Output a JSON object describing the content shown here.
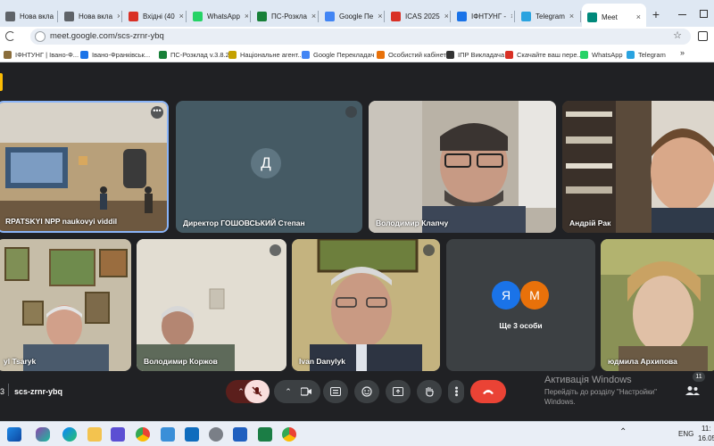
{
  "browser": {
    "tabs": [
      {
        "label": "Нова вкла",
        "icon": "new-tab-icon",
        "color": "#5f6368"
      },
      {
        "label": "Нова вкла",
        "icon": "new-tab-icon",
        "color": "#5f6368"
      },
      {
        "label": "Вхідні (40",
        "icon": "gmail-icon",
        "color": "#d93025"
      },
      {
        "label": "WhatsApp",
        "icon": "whatsapp-icon",
        "color": "#25d366"
      },
      {
        "label": "ПС-Розкла",
        "icon": "schedule-icon",
        "color": "#188038"
      },
      {
        "label": "Google Пе",
        "icon": "google-translate-icon",
        "color": "#4285f4"
      },
      {
        "label": "ICAS 2025",
        "icon": "gmail-icon",
        "color": "#d93025"
      },
      {
        "label": "ІФНТУНГ -",
        "icon": "university-icon",
        "color": "#1a73e8"
      },
      {
        "label": "Telegram",
        "icon": "telegram-icon",
        "color": "#2aa3e0"
      },
      {
        "label": "Meet",
        "icon": "google-meet-icon",
        "color": "#00897b"
      }
    ],
    "url": "meet.google.com/scs-zrnr-ybq",
    "bookmarks": [
      {
        "label": "ІФНТУНГ | Івано-Ф...",
        "color": "#8a6d3b"
      },
      {
        "label": "Івано-Франківськ...",
        "color": "#1a73e8"
      },
      {
        "label": "ПС-Розклад v.3.8.2",
        "color": "#188038"
      },
      {
        "label": "Національне агент...",
        "color": "#c5a100"
      },
      {
        "label": "Google Перекладач",
        "color": "#4285f4"
      },
      {
        "label": "Особистий кабінет",
        "color": "#e8710a"
      },
      {
        "label": "ІПР Викладача",
        "color": "#333333"
      },
      {
        "label": "Скачайте ваш пере...",
        "color": "#d93025"
      },
      {
        "label": "WhatsApp",
        "color": "#25d366"
      },
      {
        "label": "Telegram",
        "color": "#2aa3e0"
      }
    ]
  },
  "meet": {
    "participants": [
      {
        "name": "RPATSKYI NPP naukovyi viddil",
        "kind": "video"
      },
      {
        "name": "Директор ГОШОВСЬКИЙ Степан",
        "initial": "Д",
        "kind": "avatar"
      },
      {
        "name": "Володимир Клапчу",
        "kind": "video"
      },
      {
        "name": "Андрій Рак",
        "kind": "video"
      },
      {
        "name": "yl Tsaryk",
        "kind": "video"
      },
      {
        "name": "Володимир Коржов",
        "kind": "video"
      },
      {
        "name": "Ivan Danylyk",
        "kind": "video"
      },
      {
        "name": "Ще 3 особи",
        "initials": [
          "Я",
          "М"
        ],
        "kind": "others"
      },
      {
        "name": "юдмила Архипова",
        "kind": "video"
      }
    ],
    "meeting_code": "scs-zrnr-ybq",
    "time_fragment": "3",
    "people_count": "11",
    "colors": {
      "end_call": "#ea4335",
      "mic_off": "#f9dedc",
      "avatar_ya": "#1a73e8",
      "avatar_m": "#e8710a"
    }
  },
  "activation": {
    "title": "Активація Windows",
    "line1": "Перейдіть до розділу \"Настройки\"",
    "line2": "Windows."
  },
  "taskbar": {
    "language": "ENG",
    "time": "11:",
    "date": "16.05."
  }
}
